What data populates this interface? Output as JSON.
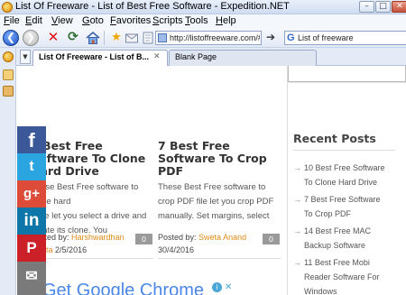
{
  "window": {
    "title": "List Of Freeware - List of Best Free Software - Expedition.NET",
    "buttons": {
      "minimize": "–",
      "maximize": "□",
      "close": "✕"
    }
  },
  "menu": [
    "File",
    "Edit",
    "View",
    "Goto",
    "Favorites",
    "Scripts",
    "Tools",
    "Help"
  ],
  "toolbar": {
    "back_glyph": "❮",
    "forward_glyph": "❯",
    "stop_glyph": "✕",
    "reload_glyph": "⟳",
    "bookmark_glyph": "★",
    "go_glyph": "➔",
    "address_value": "http://listoffreeware.com/#!",
    "search_value": "List of freeware",
    "search_engine_glyph": "G"
  },
  "tabs": {
    "menu_glyph": "▼",
    "items": [
      {
        "label": "List Of Freeware - List of B...",
        "active": true
      },
      {
        "label": "Blank Page",
        "active": false
      }
    ],
    "close_glyph": "✕"
  },
  "posts": [
    {
      "title": "7 Best Free Software To Clone Hard Drive",
      "title_lines": [
        "7 Best Free",
        "Software To Clone",
        "Hard Drive"
      ],
      "excerpt_lines": [
        "These Best Free software to clone hard",
        "drive let you select a drive and",
        "create its clone. You"
      ],
      "posted_by": "Posted by:",
      "author": "Harshwardhan",
      "author_extra": "Gupta",
      "date": "2/5/2016",
      "comments": "0"
    },
    {
      "title": "7 Best Free Software To Crop PDF",
      "title_lines": [
        "7 Best Free",
        "Software To Crop",
        "PDF"
      ],
      "excerpt_lines": [
        "These Best Free software to",
        "crop PDF file let you crop PDF",
        "manually. Set margins, select"
      ],
      "posted_by": "Posted by:",
      "author": "Sweta Anand",
      "date": "30/4/2016",
      "comments": "0"
    }
  ],
  "ad": {
    "text": "Get Google Chrome",
    "adchoices_glyph": "i",
    "close_glyph": "✕"
  },
  "social": {
    "facebook": "f",
    "twitter": "t",
    "googleplus": "g+",
    "linkedin": "in",
    "pinterest": "P",
    "email": "✉"
  },
  "sidebar": {
    "heading": "Recent Posts",
    "arrow": "→",
    "items": [
      {
        "label": "10 Best Free Software To Clone Hard Drive",
        "lines": [
          "10 Best Free Software",
          "To Clone Hard Drive"
        ]
      },
      {
        "label": "7 Best Free Software To Crop PDF",
        "lines": [
          "7 Best Free Software",
          "To Crop PDF"
        ]
      },
      {
        "label": "14 Best Free MAC Backup Software",
        "lines": [
          "14 Best Free MAC",
          "Backup Software"
        ]
      },
      {
        "label": "11 Best Free Mobi Reader Software For Windows",
        "lines": [
          "11 Best Free Mobi",
          "Reader Software For",
          "Windows"
        ]
      }
    ]
  }
}
